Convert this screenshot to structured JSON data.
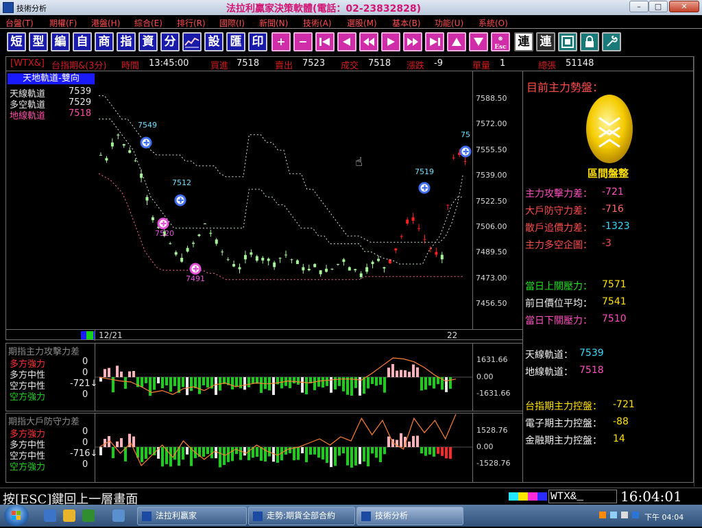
{
  "window": {
    "title": "技術分析",
    "banner": "法拉利贏家決策軟體(電話：02-23832828)",
    "controls": {
      "minimize": "–",
      "maximize": "□",
      "close": "✕"
    }
  },
  "menu": [
    {
      "label": "台盤(T)"
    },
    {
      "label": "期權(F)"
    },
    {
      "label": "港盤(H)"
    },
    {
      "label": "綜合(E)"
    },
    {
      "label": "排行(R)"
    },
    {
      "label": "國際(I)"
    },
    {
      "label": "新聞(N)"
    },
    {
      "label": "技術(A)"
    },
    {
      "label": "選股(M)"
    },
    {
      "label": "基本(B)"
    },
    {
      "label": "功能(U)"
    },
    {
      "label": "系統(O)"
    }
  ],
  "toolbar": {
    "text_buttons": [
      "短",
      "型",
      "編",
      "自",
      "商",
      "指",
      "資",
      "分"
    ],
    "buttons_mid": [
      "設",
      "匯",
      "印"
    ],
    "nav_symbols": [
      "+",
      "−",
      "◀|",
      "◀",
      "◀◀",
      "▶",
      "▶▶",
      "|▶",
      "▲",
      "▼"
    ],
    "esc_label": "Esc",
    "link_button": "連",
    "link_button2": "連"
  },
  "quote": {
    "symbol": "[WTX&]",
    "name": "台指期&(3分)",
    "time_label": "時間",
    "time": "13:45:00",
    "bid_label": "買進",
    "bid": "7518",
    "ask_label": "賣出",
    "ask": "7523",
    "last_label": "成交",
    "last": "7518",
    "change_label": "漲跌",
    "change": "-9",
    "vol_label": "單量",
    "vol": "1",
    "total_label": "總張",
    "total": "51148"
  },
  "legend": {
    "title": "天地軌道-雙向",
    "rows": [
      {
        "label": "天線軌道",
        "value": "7539",
        "color": "#e6e6e6"
      },
      {
        "label": "多空軌道",
        "value": "7529",
        "color": "#e6e6e6"
      },
      {
        "label": "地線軌道",
        "value": "7518",
        "color": "#ff4fa8"
      }
    ]
  },
  "price_axis": [
    "7588.50",
    "7572.00",
    "7555.50",
    "7539.00",
    "7522.50",
    "7506.00",
    "7489.50",
    "7473.00",
    "7456.50"
  ],
  "x_axis": {
    "start": "12/21",
    "end": "22"
  },
  "markers": [
    {
      "label": "7549",
      "type": "buy"
    },
    {
      "label": "7512",
      "type": "buy"
    },
    {
      "label": "7520",
      "type": "sell"
    },
    {
      "label": "7491",
      "type": "sell"
    },
    {
      "label": "7519",
      "type": "buy"
    },
    {
      "label": "75",
      "type": "buy"
    }
  ],
  "sub_panel_1": {
    "title": "期指主力攻擊力差",
    "rows": [
      {
        "label": "多方強力",
        "value": "0",
        "color": "#ff3030"
      },
      {
        "label": "多方中性",
        "value": "0",
        "color": "#e8e8e8"
      },
      {
        "label": "空方中性",
        "value": "-721↓",
        "color": "#e8e8e8"
      },
      {
        "label": "空方強力",
        "value": "0",
        "color": "#20d020"
      }
    ],
    "axis": [
      "1631.66",
      "0.00",
      "-1631.66"
    ]
  },
  "sub_panel_2": {
    "title": "期指大戶防守力差",
    "rows": [
      {
        "label": "多方強力",
        "value": "0",
        "color": "#ff3030"
      },
      {
        "label": "多方中性",
        "value": "0",
        "color": "#e8e8e8"
      },
      {
        "label": "空方中性",
        "value": "-716↓",
        "color": "#e8e8e8"
      },
      {
        "label": "空方強力",
        "value": "0",
        "color": "#20d020"
      }
    ],
    "axis": [
      "1528.76",
      "0.00",
      "-1528.76"
    ]
  },
  "side_panel": {
    "heading": "目前主力勢盤：",
    "trend": "區間盤整",
    "stats": [
      {
        "label": "主力攻擊力差：",
        "value": "-721",
        "color": "#ff4fc0",
        "vcolor": "#ff4fc0"
      },
      {
        "label": "大戶防守力差：",
        "value": "-716",
        "color": "#ff4d4d",
        "vcolor": "#ff6a6a"
      },
      {
        "label": "散戶追價力差：",
        "value": "-1323",
        "color": "#ff4d4d",
        "vcolor": "#3ad8ff"
      },
      {
        "label": "主力多空企圖：",
        "value": "-3",
        "color": "#ff4d4d",
        "vcolor": "#ff4d4d"
      }
    ],
    "levels": [
      {
        "label": "當日上關壓力：",
        "value": "7571",
        "color": "#20e020",
        "vcolor": "#ffe000"
      },
      {
        "label": "前日價位平均：",
        "value": "7541",
        "color": "#f2f2f2",
        "vcolor": "#ffe000"
      },
      {
        "label": "當日下關壓力：",
        "value": "7510",
        "color": "#ff4fc0",
        "vcolor": "#ff4fc0"
      }
    ],
    "tracks": [
      {
        "label": "天線軌道：",
        "value": "7539",
        "color": "#f2f2f2",
        "vcolor": "#3ad8ff"
      },
      {
        "label": "地線軌道：",
        "value": "7518",
        "color": "#f2f2f2",
        "vcolor": "#ff4fc0"
      }
    ],
    "control": [
      {
        "label": "台指期主力控盤：",
        "value": "-721",
        "color": "#ffe000",
        "vcolor": "#ffe000"
      },
      {
        "label": "電子期主力控盤：",
        "value": "-88",
        "color": "#f2f2f2",
        "vcolor": "#ffe000"
      },
      {
        "label": "金融期主力控盤：",
        "value": "14",
        "color": "#f2f2f2",
        "vcolor": "#ffe000"
      }
    ]
  },
  "status": {
    "message": "按[ESC]鍵回上一層畫面",
    "code": "WTX&_",
    "clock": "16:04:01"
  },
  "taskbar": {
    "tasks": [
      "法拉利贏家",
      "走勢:期貨全部合約",
      "技術分析"
    ],
    "clock": "下午 04:04"
  }
}
